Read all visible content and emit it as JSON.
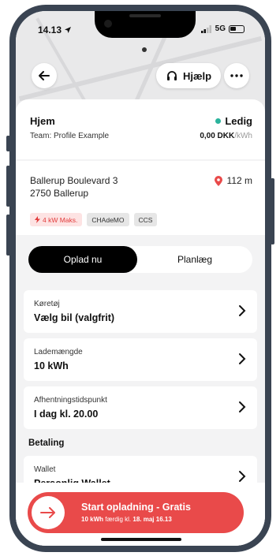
{
  "status_bar": {
    "time": "14.13",
    "network": "5G"
  },
  "header": {
    "help_label": "Hjælp"
  },
  "location": {
    "title": "Hjem",
    "team": "Team: Profile Example",
    "status": "Ledig",
    "price": "0,00 DKK",
    "price_unit": "/kWh"
  },
  "address": {
    "line1": "Ballerup Boulevard 3",
    "line2": "2750 Ballerup",
    "distance": "112 m",
    "tags": [
      "4 kW Maks.",
      "CHAdeMO",
      "CCS"
    ]
  },
  "tabs": {
    "active": "Oplad nu",
    "inactive": "Planlæg"
  },
  "rows": [
    {
      "label": "Køretøj",
      "value": "Vælg bil (valgfrit)"
    },
    {
      "label": "Lademængde",
      "value": "10 kWh"
    },
    {
      "label": "Afhentningstidspunkt",
      "value": "I dag kl. 20.00"
    }
  ],
  "payment": {
    "section_label": "Betaling",
    "wallet_label": "Wallet",
    "wallet_value": "Personlig Wallet"
  },
  "cta": {
    "title": "Start opladning - Gratis",
    "sub_prefix": "10 kWh",
    "sub_middle": "færdig kl.",
    "sub_time": "18. maj 16.13"
  },
  "colors": {
    "accent": "#e94a4a",
    "available": "#2bb39c",
    "frame": "#3a4452"
  }
}
